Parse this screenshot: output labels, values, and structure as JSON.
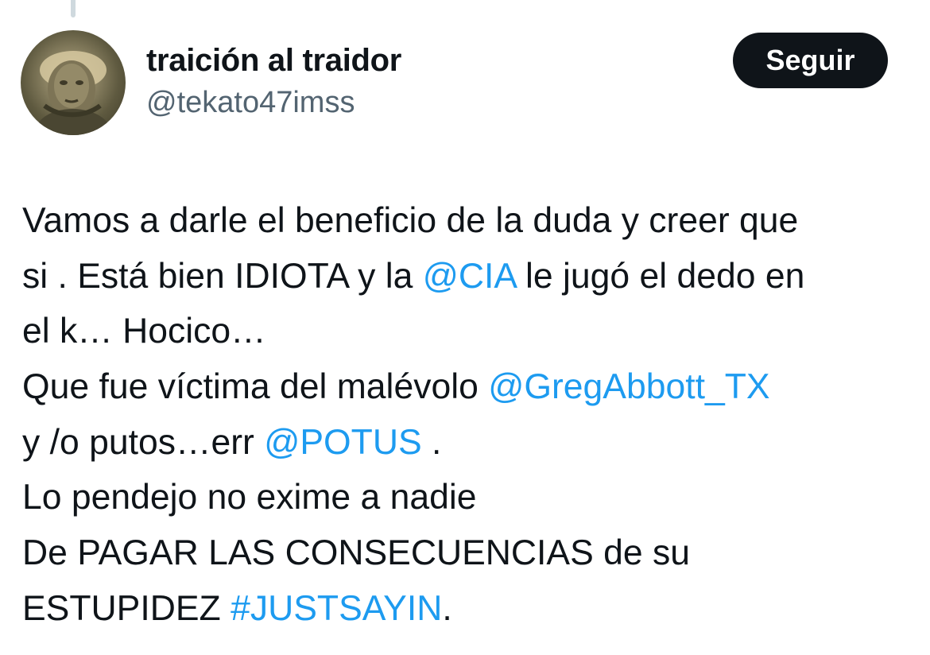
{
  "user": {
    "display_name": "traición al traidor",
    "handle": "@tekato47imss",
    "avatar_icon": "profile-photo"
  },
  "follow_button": {
    "label": "Seguir"
  },
  "tweet": {
    "lines": [
      [
        {
          "text": "Vamos a darle el beneficio de la duda y creer que"
        }
      ],
      [
        {
          "text": "si . Está bien IDIOTA y la "
        },
        {
          "text": "@CIA",
          "type": "mention"
        },
        {
          "text": " le jugó el dedo en"
        }
      ],
      [
        {
          "text": "el k… Hocico…"
        }
      ],
      [
        {
          "text": "Que fue víctima del malévolo "
        },
        {
          "text": "@GregAbbott_TX",
          "type": "mention"
        }
      ],
      [
        {
          "text": "y /o putos…err "
        },
        {
          "text": "@POTUS",
          "type": "mention"
        },
        {
          "text": " ."
        }
      ],
      [
        {
          "text": "Lo pendejo no exime a nadie"
        }
      ],
      [
        {
          "text": "De PAGAR LAS CONSECUENCIAS de su"
        }
      ],
      [
        {
          "text": "ESTUPIDEZ "
        },
        {
          "text": "#JUSTSAYIN",
          "type": "hashtag"
        },
        {
          "text": "."
        }
      ]
    ]
  },
  "colors": {
    "link": "#1d9bf0",
    "text": "#0f1419",
    "secondary": "#536471",
    "button_bg": "#0f1419",
    "thread_line": "#cfd9de"
  }
}
